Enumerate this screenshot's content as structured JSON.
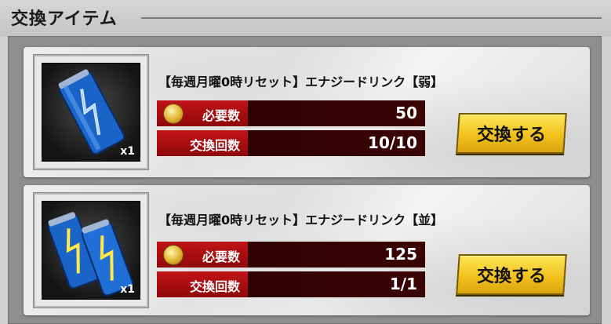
{
  "header": {
    "title": "交換アイテム"
  },
  "items": [
    {
      "name": "【毎週月曜0時リセット】エナジードリンク【弱】",
      "quantity": "x1",
      "icon": "energy-drink-single-icon",
      "required_label": "必要数",
      "required_value": "50",
      "count_label": "交換回数",
      "count_value": "10/10",
      "button_label": "交換する"
    },
    {
      "name": "【毎週月曜0時リセット】エナジードリンク【並】",
      "quantity": "x1",
      "icon": "energy-drink-double-icon",
      "required_label": "必要数",
      "required_value": "125",
      "count_label": "交換回数",
      "count_value": "1/1",
      "button_label": "交換する"
    }
  ],
  "colors": {
    "accent_red": "#c11417",
    "button_yellow": "#f2c21c",
    "row_dark": "#2a0000"
  }
}
